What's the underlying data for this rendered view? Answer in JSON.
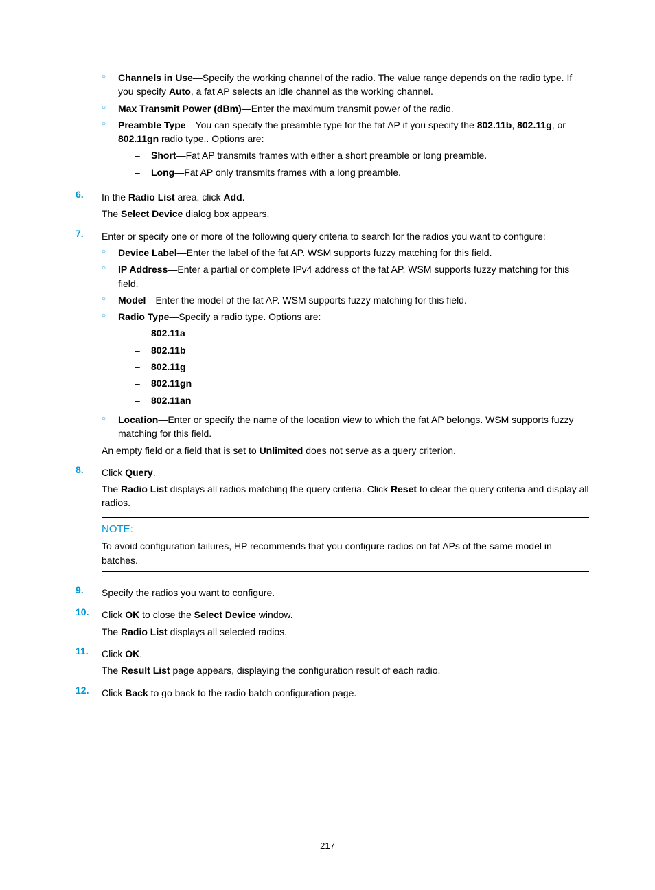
{
  "pageNumber": "217",
  "topSubs": [
    {
      "term": "Channels in Use",
      "bold2": "Auto",
      "text1": "—Specify the working channel of the radio. The value range depends on the radio type. If you specify ",
      "text2": ", a fat AP selects an idle channel as the working channel."
    },
    {
      "term": "Max Transmit Power (dBm)",
      "text": "—Enter the maximum transmit power of the radio."
    },
    {
      "term": "Preamble Type",
      "text1": "—You can specify the preamble type for the fat AP if you specify the ",
      "b1": "802.11b",
      "c1": ", ",
      "b2": "802.11g",
      "c2": ", or ",
      "b3": "802.11gn",
      "text2": " radio type.. Options are:",
      "subsubs": [
        {
          "term": "Short",
          "text": "—Fat AP transmits frames with either a short preamble or long preamble."
        },
        {
          "term": "Long",
          "text": "—Fat AP only transmits frames with a long preamble."
        }
      ]
    }
  ],
  "step6": {
    "num": "6.",
    "line1_a": "In the ",
    "line1_b": "Radio List",
    "line1_c": " area, click ",
    "line1_d": "Add",
    "line1_e": ".",
    "line2_a": "The ",
    "line2_b": "Select Device",
    "line2_c": " dialog box appears."
  },
  "step7": {
    "num": "7.",
    "intro": "Enter or specify one or more of the following query criteria to search for the radios you want to configure:",
    "subs": [
      {
        "term": "Device Label",
        "text": "—Enter the label of the fat AP. WSM supports fuzzy matching for this field."
      },
      {
        "term": "IP Address",
        "text": "—Enter a partial or complete IPv4 address of the fat AP. WSM supports fuzzy matching for this field."
      },
      {
        "term": "Model",
        "text": "—Enter the model of the fat AP. WSM supports fuzzy matching for this field."
      },
      {
        "term": "Radio Type",
        "text": "—Specify a radio type. Options are:",
        "opts": [
          "802.11a",
          "802.11b",
          "802.11g",
          "802.11gn",
          "802.11an"
        ]
      },
      {
        "term": "Location",
        "text": "—Enter or specify the name of the location view to which the fat AP belongs. WSM supports fuzzy matching for this field."
      }
    ],
    "tail_a": "An empty field or a field that is set to ",
    "tail_b": "Unlimited",
    "tail_c": " does not serve as a query criterion."
  },
  "step8": {
    "num": "8.",
    "line1_a": "Click ",
    "line1_b": "Query",
    "line1_c": ".",
    "line2_a": "The ",
    "line2_b": "Radio List",
    "line2_c": " displays all radios matching the query criteria. Click ",
    "line2_d": "Reset",
    "line2_e": " to clear the query criteria and display all radios."
  },
  "note": {
    "label": "NOTE:",
    "text": "To avoid configuration failures, HP recommends that you configure radios on fat APs of the same model in batches."
  },
  "step9": {
    "num": "9.",
    "text": "Specify the radios you want to configure."
  },
  "step10": {
    "num": "10.",
    "l1a": "Click ",
    "l1b": "OK",
    "l1c": " to close the ",
    "l1d": "Select Device",
    "l1e": " window.",
    "l2a": "The ",
    "l2b": "Radio List",
    "l2c": " displays all selected radios."
  },
  "step11": {
    "num": "11.",
    "l1a": "Click ",
    "l1b": "OK",
    "l1c": ".",
    "l2a": "The ",
    "l2b": "Result List",
    "l2c": " page appears, displaying the configuration result of each radio."
  },
  "step12": {
    "num": "12.",
    "a": "Click ",
    "b": "Back",
    "c": " to go back to the radio batch configuration page."
  }
}
